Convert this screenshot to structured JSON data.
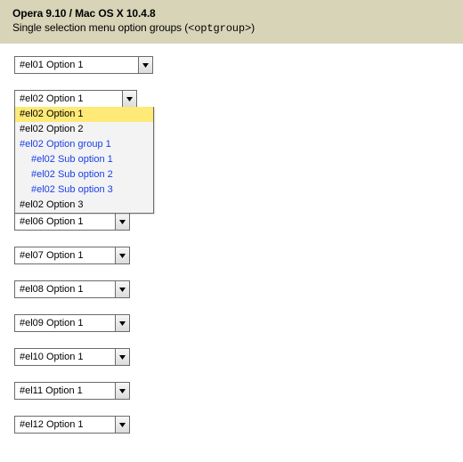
{
  "header": {
    "line1": "Opera 9.10 / Mac OS X 10.4.8",
    "line2_prefix": "Single selection menu option groups (",
    "line2_code": "<optgroup>",
    "line2_suffix": ")"
  },
  "selects": {
    "el01": {
      "value": "#el01 Option 1"
    },
    "el02": {
      "value": "#el02 Option 1",
      "options": [
        {
          "label": "#el02 Option 1",
          "type": "option",
          "highlight": true
        },
        {
          "label": "#el02 Option 2",
          "type": "option"
        },
        {
          "label": "#el02 Option group 1",
          "type": "optgroup"
        },
        {
          "label": "#el02 Sub option 1",
          "type": "suboption"
        },
        {
          "label": "#el02 Sub option 2",
          "type": "suboption"
        },
        {
          "label": "#el02 Sub option 3",
          "type": "suboption"
        },
        {
          "label": "#el02 Option 3",
          "type": "option"
        }
      ]
    },
    "el06": {
      "value": "#el06 Option 1"
    },
    "el07": {
      "value": "#el07 Option 1"
    },
    "el08": {
      "value": "#el08 Option 1"
    },
    "el09": {
      "value": "#el09 Option 1"
    },
    "el10": {
      "value": "#el10 Option 1"
    },
    "el11": {
      "value": "#el11 Option 1"
    },
    "el12": {
      "value": "#el12 Option 1"
    }
  }
}
